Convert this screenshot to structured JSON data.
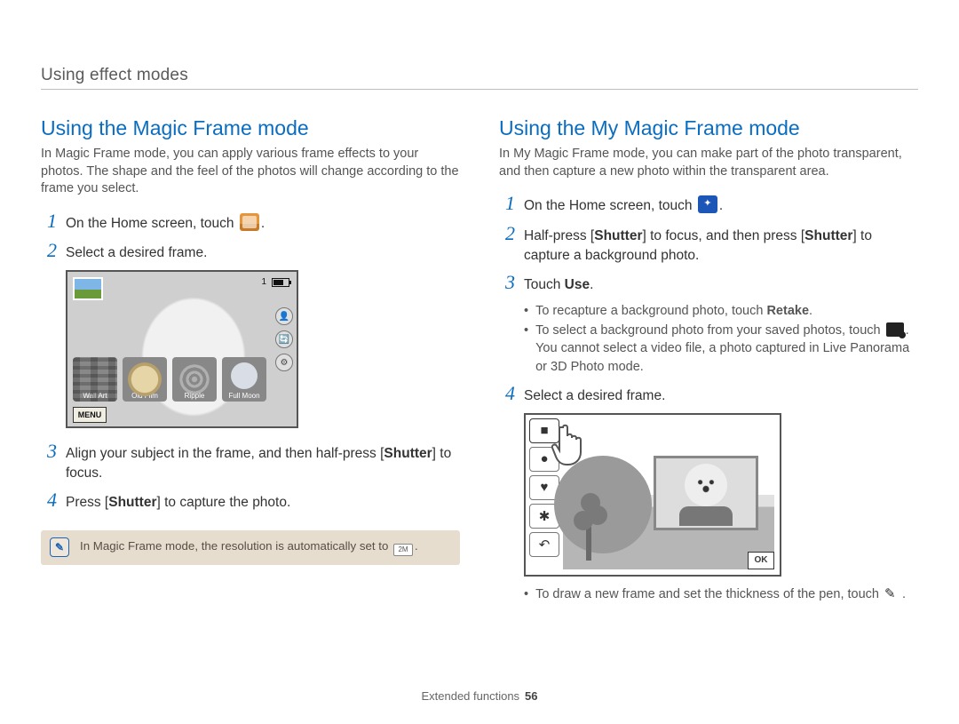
{
  "header": {
    "breadcrumb": "Using effect modes"
  },
  "left": {
    "title": "Using the Magic Frame mode",
    "desc": "In Magic Frame mode, you can apply various frame effects to your photos. The shape and the feel of the photos will change according to the frame you select.",
    "steps": {
      "s1a": "On the Home screen, touch ",
      "s1b": ".",
      "s2": "Select a desired frame.",
      "s3a": "Align your subject in the frame, and then half-press [",
      "s3b": "Shutter",
      "s3c": "] to focus.",
      "s4a": "Press [",
      "s4b": "Shutter",
      "s4c": "] to capture the photo."
    },
    "illus": {
      "count": "1",
      "menu": "MENU",
      "frames": [
        "Wall Art",
        "Old Film",
        "Ripple",
        "Full Moon"
      ],
      "side": [
        "👤",
        "🔄",
        "⚙"
      ]
    },
    "note": "In Magic Frame mode, the resolution is automatically set to ",
    "note_res": "2M"
  },
  "right": {
    "title": "Using the My Magic Frame mode",
    "desc": "In My Magic Frame mode, you can make part of the photo transparent, and then capture a new photo within the transparent area.",
    "steps": {
      "s1a": "On the Home screen, touch ",
      "s1b": ".",
      "s2a": "Half-press [",
      "s2b": "Shutter",
      "s2c": "] to focus, and then press [",
      "s2d": "Shutter",
      "s2e": "] to capture a background photo.",
      "s3a": "Touch ",
      "s3b": "Use",
      "s3c": ".",
      "s4": "Select a desired frame."
    },
    "bullets3": {
      "b1a": "To recapture a background photo, touch ",
      "b1b": "Retake",
      "b1c": ".",
      "b2a": "To select a background photo from your saved photos, touch ",
      "b2b": ". You cannot select a video file, a photo captured in Live Panorama or 3D Photo mode."
    },
    "illus": {
      "ok": "OK"
    },
    "bullets4": {
      "b1a": "To draw a new frame and set the thickness of the pen, touch ",
      "b1b": "."
    }
  },
  "footer": {
    "section": "Extended functions",
    "page": "56"
  }
}
